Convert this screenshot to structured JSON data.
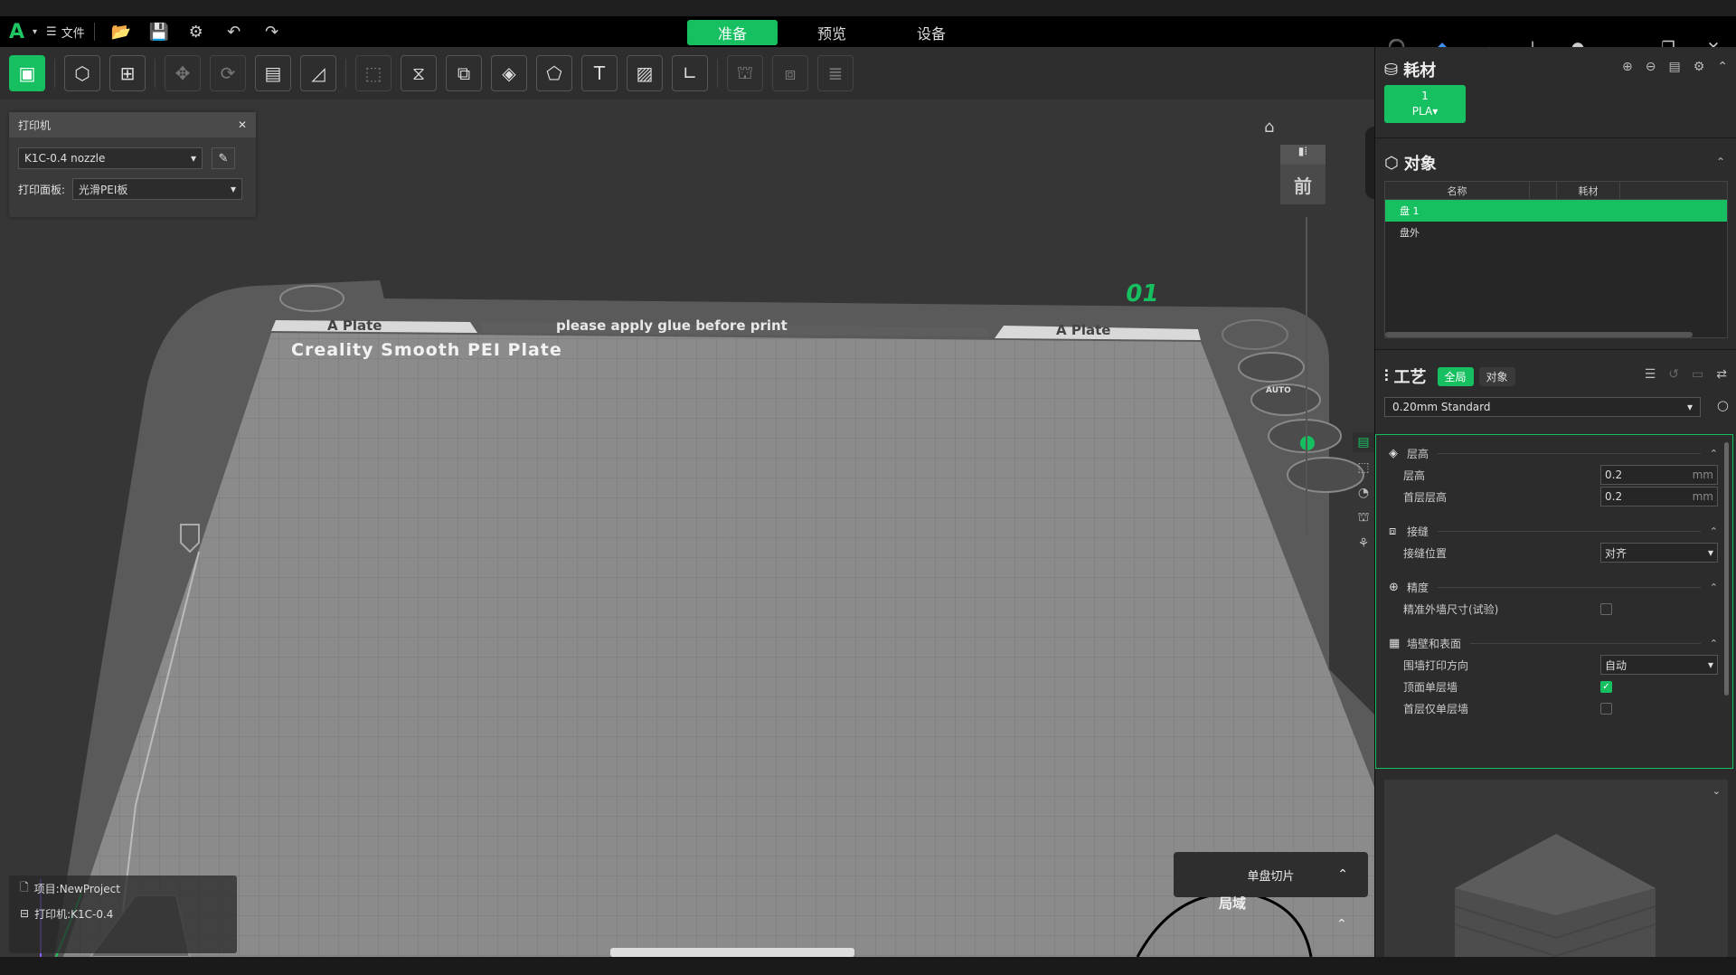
{
  "titlebar": {
    "logo": "A",
    "file_menu": "文件",
    "tabs": [
      "准备",
      "预览",
      "设备"
    ],
    "active_tab": "准备"
  },
  "printer_panel": {
    "title": "打印机",
    "printer_select": "K1C-0.4 nozzle",
    "plate_label": "打印面板:",
    "plate_select": "光滑PEI板"
  },
  "bed": {
    "plate_number": "01",
    "label_left": "A Plate",
    "label_center": "please apply glue before print",
    "label_right": "A Plate",
    "plate_name": "Creality Smooth PEI Plate"
  },
  "view": {
    "front_label": "前",
    "auto_label": "AUTO"
  },
  "filament": {
    "title": "耗材",
    "slot_number": "1",
    "slot_type": "PLA"
  },
  "objects": {
    "title": "对象",
    "col_name": "名称",
    "col_filament": "耗材",
    "rows": [
      "盘 1",
      "盘外"
    ]
  },
  "process": {
    "title": "工艺",
    "tab_global": "全局",
    "tab_object": "对象",
    "preset": "0.20mm Standard",
    "groups": {
      "layer": {
        "title": "层高",
        "layer_height_label": "层高",
        "layer_height": "0.2",
        "first_layer_label": "首层层高",
        "first_layer": "0.2",
        "unit": "mm"
      },
      "seam": {
        "title": "接缝",
        "position_label": "接缝位置",
        "position": "对齐"
      },
      "precision": {
        "title": "精度",
        "precise_wall_label": "精准外墙尺寸(试验)"
      },
      "walls": {
        "title": "墙壁和表面",
        "direction_label": "围墙打印方向",
        "direction": "自动",
        "top_single_label": "顶面单层墙",
        "first_single_label": "首层仅单层墙"
      }
    }
  },
  "status": {
    "project": "项目:NewProject",
    "printer": "打印机:K1C-0.4"
  },
  "slice": {
    "button": "单盘切片",
    "secondary": "局域"
  },
  "colors": {
    "accent": "#16c060",
    "background": "#363636",
    "panel": "#2c2c2c"
  }
}
